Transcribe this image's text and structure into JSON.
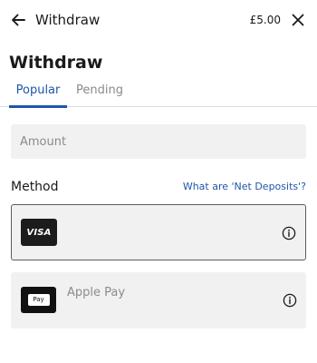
{
  "header": {
    "back_icon": "arrow-left-icon",
    "title": "Withdraw",
    "balance": "£5.00",
    "close_icon": "close-icon"
  },
  "page": {
    "title": "Withdraw"
  },
  "tabs": [
    {
      "label": "Popular",
      "active": true
    },
    {
      "label": "Pending",
      "active": false
    }
  ],
  "amount": {
    "placeholder": "Amount",
    "value": ""
  },
  "methods": {
    "label": "Method",
    "link": "What are 'Net Deposits'?",
    "items": [
      {
        "logo": "VISA",
        "label": "",
        "selected": true,
        "info_icon": "info-icon"
      },
      {
        "logo": "Pay",
        "label": "Apple Pay",
        "selected": false,
        "info_icon": "info-icon"
      }
    ]
  },
  "colors": {
    "accent": "#1f56a8",
    "field_background": "#f1f1f1",
    "selected_border": "#5d5d5d",
    "muted_text": "#8b8b8b"
  }
}
